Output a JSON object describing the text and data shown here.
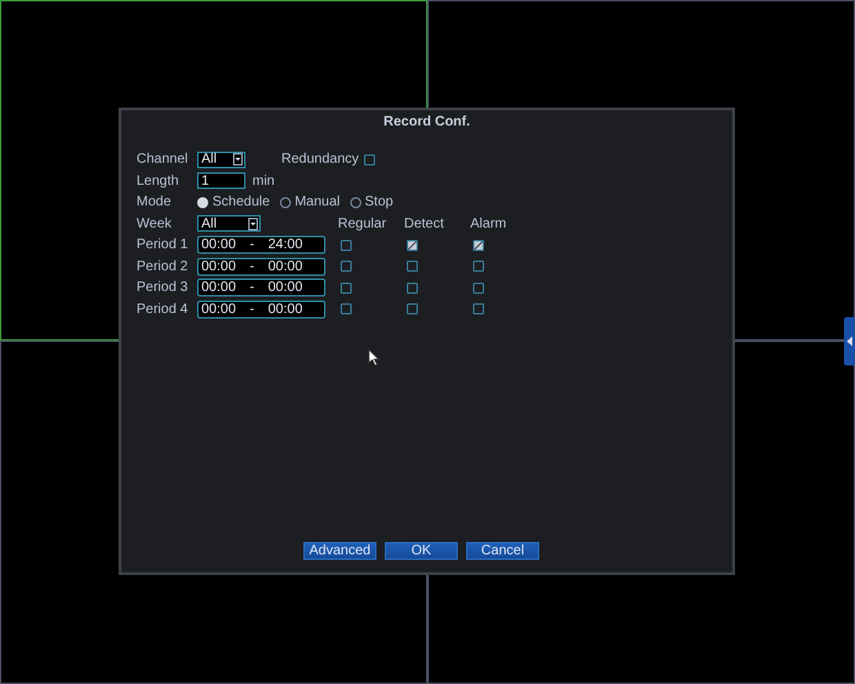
{
  "panes": [
    {
      "selected": true
    },
    {
      "selected": false
    },
    {
      "selected": false
    },
    {
      "selected": false
    }
  ],
  "dialog": {
    "title": "Record Conf.",
    "channel": {
      "label": "Channel",
      "value": "All"
    },
    "redundancy": {
      "label": "Redundancy",
      "checked": false
    },
    "length": {
      "label": "Length",
      "value": "1",
      "unit": "min"
    },
    "mode": {
      "label": "Mode",
      "options": [
        {
          "label": "Schedule",
          "selected": true
        },
        {
          "label": "Manual",
          "selected": false
        },
        {
          "label": "Stop",
          "selected": false
        }
      ]
    },
    "week": {
      "label": "Week",
      "value": "All"
    },
    "columns": [
      "Regular",
      "Detect",
      "Alarm"
    ],
    "periods": [
      {
        "label": "Period 1",
        "start": "00:00",
        "separator": "-",
        "end": "24:00",
        "regular": false,
        "detect": true,
        "alarm": true
      },
      {
        "label": "Period 2",
        "start": "00:00",
        "separator": "-",
        "end": "00:00",
        "regular": false,
        "detect": false,
        "alarm": false
      },
      {
        "label": "Period 3",
        "start": "00:00",
        "separator": "-",
        "end": "00:00",
        "regular": false,
        "detect": false,
        "alarm": false
      },
      {
        "label": "Period 4",
        "start": "00:00",
        "separator": "-",
        "end": "00:00",
        "regular": false,
        "detect": false,
        "alarm": false
      }
    ],
    "buttons": [
      "Advanced",
      "OK",
      "Cancel"
    ]
  }
}
